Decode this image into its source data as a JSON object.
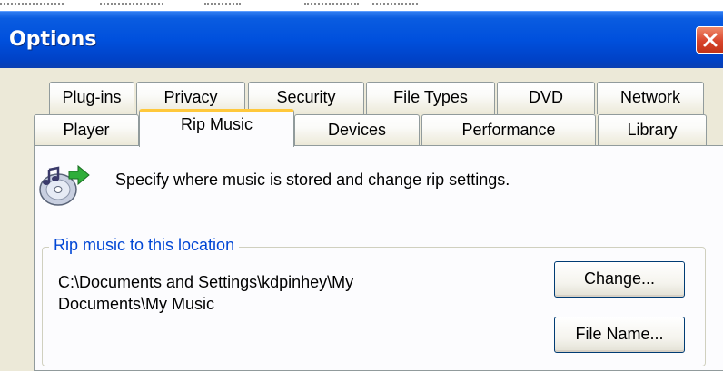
{
  "window": {
    "title": "Options",
    "title_color": "#0050dd"
  },
  "tabs": {
    "row_top": [
      "Plug-ins",
      "Privacy",
      "Security",
      "File Types",
      "DVD",
      "Network"
    ],
    "row_bottom": [
      "Player",
      "Rip Music",
      "Devices",
      "Performance",
      "Library"
    ],
    "selected": "Rip Music"
  },
  "panel": {
    "description": "Specify where music is stored and change rip settings.",
    "icon": "music-cd-icon"
  },
  "rip_location": {
    "group_label": "Rip music to this location",
    "path_line1": "C:\\Documents and Settings\\kdpinhey\\My",
    "path_line2": "Documents\\My Music",
    "change_button": "Change...",
    "file_name_button": "File Name..."
  },
  "colors": {
    "accent_tab": "#ffc83c",
    "group_label": "#0046d5",
    "close_button": "#d8452c"
  }
}
